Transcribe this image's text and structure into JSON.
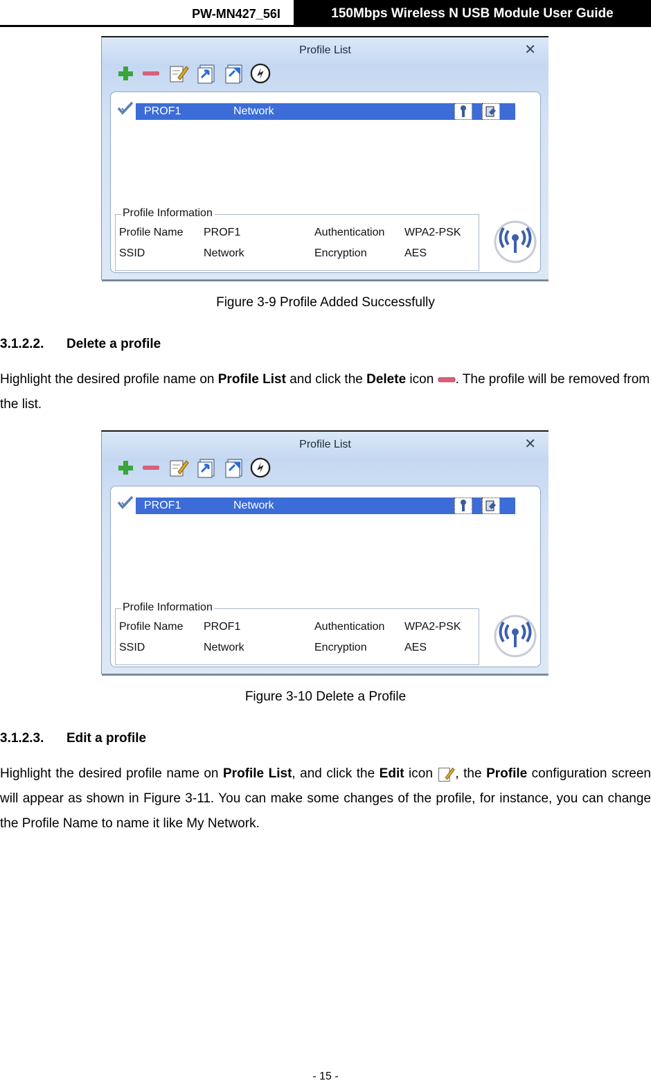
{
  "header": {
    "model": "PW-MN427_56I",
    "guide_title": "150Mbps Wireless N USB Module User Guide"
  },
  "dialog": {
    "title": "Profile List",
    "close_glyph": "✕",
    "toolbar_icons": [
      "add-icon",
      "delete-icon",
      "edit-icon",
      "import-icon",
      "export-icon",
      "scan-icon"
    ],
    "profile_row": {
      "profile_name": "PROF1",
      "ssid": "Network"
    },
    "info": {
      "legend": "Profile Information",
      "profile_name_label": "Profile Name",
      "profile_name_value": "PROF1",
      "ssid_label": "SSID",
      "ssid_value": "Network",
      "auth_label": "Authentication",
      "auth_value": "WPA2-PSK",
      "enc_label": "Encryption",
      "enc_value": "AES"
    }
  },
  "figures": {
    "fig1_caption": "Figure 3-9 Profile Added Successfully",
    "fig2_caption": "Figure 3-10 Delete a Profile"
  },
  "section_delete": {
    "number": "3.1.2.2.",
    "title": "Delete a profile",
    "text_1": "Highlight the desired profile name on ",
    "bold_1": "Profile List",
    "text_2": " and click the ",
    "bold_2": "Delete",
    "text_3": " icon ",
    "text_4": ". The profile will be removed from the list."
  },
  "section_edit": {
    "number": "3.1.2.3.",
    "title": "Edit a profile",
    "text_1": "Highlight the desired profile name on ",
    "bold_1": "Profile List",
    "text_2": ", and click the ",
    "bold_2": "Edit",
    "text_3": " icon ",
    "text_4": ", the ",
    "bold_3": "Profile",
    "text_5": " configuration screen will appear as shown in Figure 3-11. You can make some changes of the profile, for instance, you can change the Profile Name to name it like My Network."
  },
  "footer": {
    "page_number": "- 15 -"
  },
  "colors": {
    "row_highlight": "#3b6cd8",
    "add_green": "#3aa53a",
    "delete_red": "#d9607a",
    "dialog_bg": "#d3e2f6"
  }
}
